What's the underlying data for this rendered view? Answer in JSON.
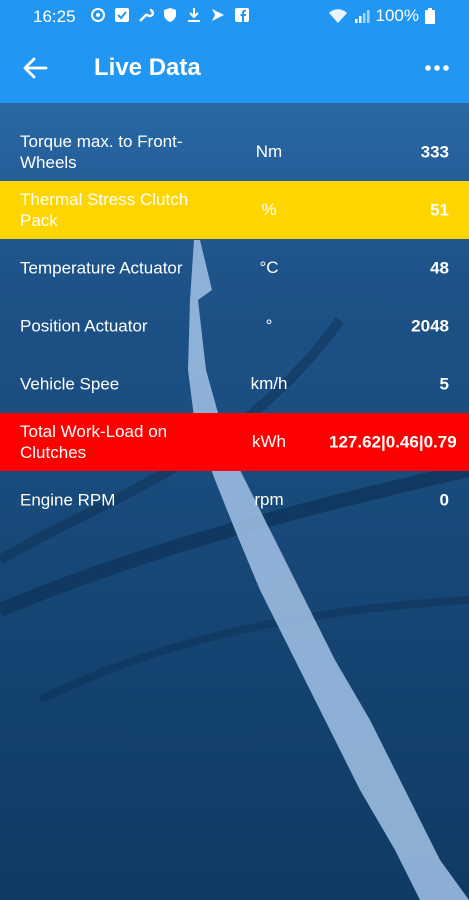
{
  "status_bar": {
    "time": "16:25",
    "battery": "100%",
    "icons": [
      "sync-icon",
      "checkbox-icon",
      "wrench-icon",
      "shield-icon",
      "download-icon",
      "send-icon",
      "facebook-icon"
    ]
  },
  "app_bar": {
    "title": "Live Data",
    "back_icon": "arrow-left-icon",
    "menu_icon": "more-horizontal-icon"
  },
  "rows": [
    {
      "name": "Torque max. to Front-Wheels",
      "unit": "Nm",
      "value": "333",
      "highlight": "none"
    },
    {
      "name": "Thermal Stress Clutch Pack",
      "unit": "%",
      "value": "51",
      "highlight": "yellow"
    },
    {
      "name": "Temperature Actuator",
      "unit": "°C",
      "value": "48",
      "highlight": "none"
    },
    {
      "name": "Position Actuator",
      "unit": "°",
      "value": "2048",
      "highlight": "none"
    },
    {
      "name": "Vehicle Spee",
      "unit": "km/h",
      "value": "5",
      "highlight": "none"
    },
    {
      "name": "Total Work-Load on Clutches",
      "unit": "kWh",
      "value": "127.62|0.46|0.79",
      "highlight": "red"
    },
    {
      "name": "Engine RPM",
      "unit": "rpm",
      "value": "0",
      "highlight": "none"
    }
  ],
  "colors": {
    "app_bar": "#2196f3",
    "highlight_yellow": "#ffd500",
    "highlight_red": "#ff0000"
  }
}
